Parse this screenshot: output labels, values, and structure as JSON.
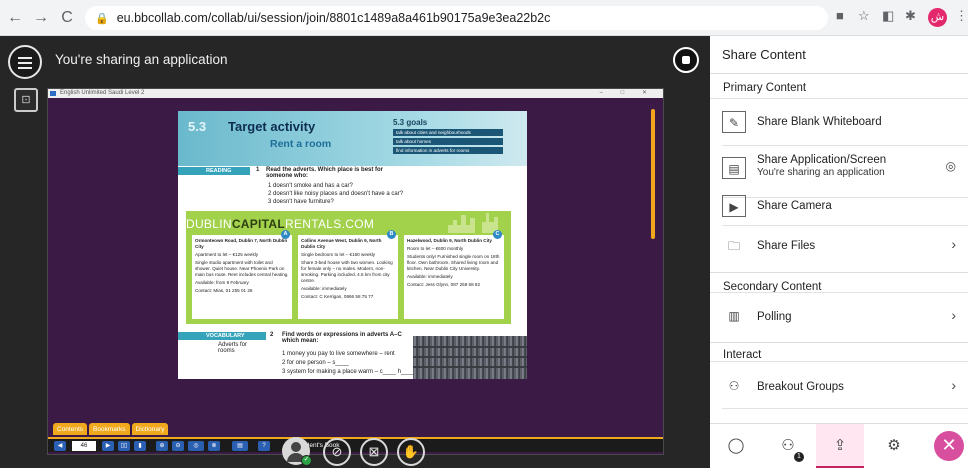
{
  "browser": {
    "url": "eu.bbcollab.com/collab/ui/session/join/8801c1489a8a461b90175a9e3ea22b2c",
    "profile_initial": "ش"
  },
  "session": {
    "sharing_title": "You're sharing an application"
  },
  "app": {
    "window_title": "English Unlimited Saudi Level 2",
    "unit": "5.3",
    "heading": "Target activity",
    "subheading": "Rent a room",
    "goals_title": "5.3 goals",
    "goals": [
      "talk about cities and neighbourhoods",
      "talk about homes",
      "find information in adverts for rooms"
    ],
    "reading_label": "READING",
    "reading_q": "1",
    "reading_prompt": "Read the adverts. Which place is best for someone who:",
    "reading_items": [
      "1   doesn't smoke and has a car?",
      "2   doesn't like noisy places and doesn't have a car?",
      "3   doesn't have furniture?"
    ],
    "ad_brand_pre": "DUBLIN",
    "ad_brand_bold": "CAPITAL",
    "ad_brand_post": "RENTALS.COM",
    "ads": [
      {
        "badge": "A",
        "title": "Ormonteown Road, Dublin 7, North Dublin City",
        "price": "Apartment to let – €125 weekly",
        "desc": "Single studio apartment with toilet and shower. Quiet house. Near Phoenix Park on main bus route. Rent includes central heating.",
        "avail": "Available: from 8 February",
        "contact": "Contact: Mias, 01 255 01 26"
      },
      {
        "badge": "B",
        "title": "Collins Avenue West, Dublin 9, North Dublin City",
        "price": "Single bedroom to let – €160 weekly",
        "desc": "Share 3-bed house with two women. Looking for female only – no males. Modern, non-smoking. Parking included. 4.5 km from city centre.",
        "avail": "Available: immediately",
        "contact": "Contact: C Kerrigan, 0866 58 75 77"
      },
      {
        "badge": "C",
        "title": "Hazelwood, Dublin 9, North Dublin City",
        "price": "Room to let – €600 monthly",
        "desc": "Students only! Furnished single room on 18th floor. Own bathroom. Shared living room and kitchen. Near Dublin City University.",
        "avail": "Available: immediately",
        "contact": "Contact: Jess Glynn, 087 259 58 82"
      }
    ],
    "vocab_label": "VOCABULARY",
    "vocab_q": "2",
    "vocab_prompt": "Find words or expressions in adverts A–C which mean:",
    "vocab_sub": "Adverts for rooms",
    "vocab_items": [
      "1   money you pay to live somewhere – rent",
      "2   for one person – s____",
      "3   system for making a place warm – c____ h____"
    ],
    "bottom_tabs": [
      "Contents",
      "Bookmarks",
      "Dictionary"
    ],
    "page_number": "46",
    "book_label": "Student's Book"
  },
  "panel": {
    "title": "Share Content",
    "primary": "Primary Content",
    "blank_whiteboard": "Share Blank Whiteboard",
    "share_app": "Share Application/Screen",
    "share_app_sub": "You're sharing an application",
    "share_camera": "Share Camera",
    "share_files": "Share Files",
    "secondary": "Secondary Content",
    "polling": "Polling",
    "interact": "Interact",
    "breakout": "Breakout Groups",
    "attendee_badge": "1"
  }
}
